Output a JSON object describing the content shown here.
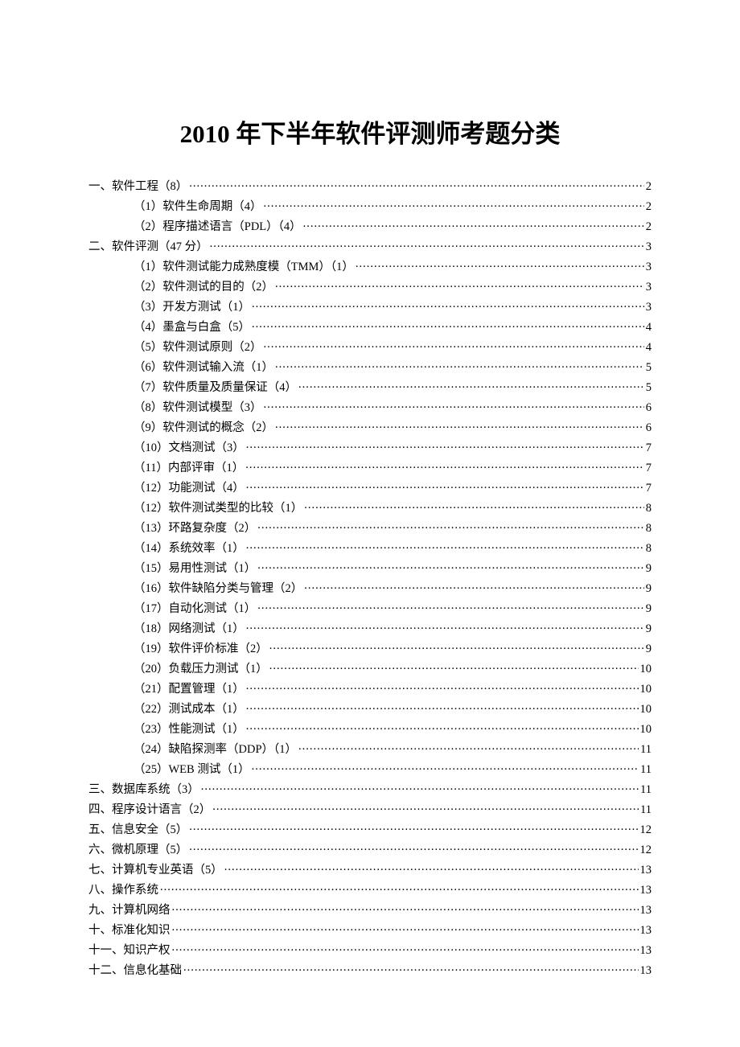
{
  "title": "2010 年下半年软件评测师考题分类",
  "toc": [
    {
      "level": 1,
      "label": "一、软件工程（8）",
      "page": "2"
    },
    {
      "level": 2,
      "label": "（1）软件生命周期（4）",
      "page": "2"
    },
    {
      "level": 2,
      "label": "（2）程序描述语言（PDL）（4）",
      "page": "2"
    },
    {
      "level": 1,
      "label": "二、软件评测（47 分）",
      "page": "3"
    },
    {
      "level": 2,
      "label": "（1）软件测试能力成熟度模（TMM）（1）",
      "page": "3"
    },
    {
      "level": 2,
      "label": "（2）软件测试的目的（2）",
      "page": "3"
    },
    {
      "level": 2,
      "label": "（3）开发方测试（1）",
      "page": "3"
    },
    {
      "level": 2,
      "label": "（4）墨盒与白盒（5）",
      "page": "4"
    },
    {
      "level": 2,
      "label": "（5）软件测试原则（2）",
      "page": "4"
    },
    {
      "level": 2,
      "label": "（6）软件测试输入流（1）",
      "page": "5"
    },
    {
      "level": 2,
      "label": "（7）软件质量及质量保证（4）",
      "page": "5"
    },
    {
      "level": 2,
      "label": "（8）软件测试模型（3）",
      "page": "6"
    },
    {
      "level": 2,
      "label": "（9）软件测试的概念（2）",
      "page": "6"
    },
    {
      "level": 2,
      "label": "（10）文档测试（3）",
      "page": "7"
    },
    {
      "level": 2,
      "label": "（11）内部评审（1）",
      "page": "7"
    },
    {
      "level": 2,
      "label": "（12）功能测试（4）",
      "page": "7"
    },
    {
      "level": 2,
      "label": "（12）软件测试类型的比较（1）",
      "page": "8"
    },
    {
      "level": 2,
      "label": "（13）环路复杂度（2）",
      "page": "8"
    },
    {
      "level": 2,
      "label": "（14）系统效率（1）",
      "page": "8"
    },
    {
      "level": 2,
      "label": "（15）易用性测试（1）",
      "page": "9"
    },
    {
      "level": 2,
      "label": "（16）软件缺陷分类与管理（2）",
      "page": "9"
    },
    {
      "level": 2,
      "label": "（17）自动化测试（1）",
      "page": "9"
    },
    {
      "level": 2,
      "label": "（18）网络测试（1）",
      "page": "9"
    },
    {
      "level": 2,
      "label": "（19）软件评价标准（2）",
      "page": "9"
    },
    {
      "level": 2,
      "label": "（20）负载压力测试（1）",
      "page": "10"
    },
    {
      "level": 2,
      "label": "（21）配置管理（1）",
      "page": "10"
    },
    {
      "level": 2,
      "label": "（22）测试成本（1）",
      "page": "10"
    },
    {
      "level": 2,
      "label": "（23）性能测试（1）",
      "page": "10"
    },
    {
      "level": 2,
      "label": "（24）缺陷探测率（DDP）（1）",
      "page": "11"
    },
    {
      "level": 2,
      "label": "（25）WEB 测试（1）",
      "page": "11"
    },
    {
      "level": 1,
      "label": "三、数据库系统（3）",
      "page": "11"
    },
    {
      "level": 1,
      "label": "四、程序设计语言（2）",
      "page": "11"
    },
    {
      "level": 1,
      "label": "五、信息安全（5）",
      "page": "12"
    },
    {
      "level": 1,
      "label": "六、微机原理（5）",
      "page": "12"
    },
    {
      "level": 1,
      "label": "七、计算机专业英语（5）",
      "page": "13"
    },
    {
      "level": 1,
      "label": "八、操作系统",
      "page": "13"
    },
    {
      "level": 1,
      "label": "九、计算机网络",
      "page": "13"
    },
    {
      "level": 1,
      "label": "十、标准化知识",
      "page": "13"
    },
    {
      "level": 1,
      "label": "十一、知识产权",
      "page": "13"
    },
    {
      "level": 1,
      "label": "十二、信息化基础",
      "page": "13"
    }
  ]
}
